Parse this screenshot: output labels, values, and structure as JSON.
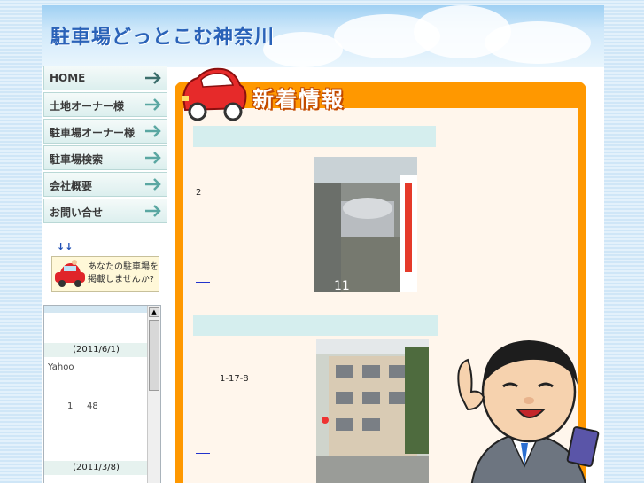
{
  "header": {
    "site_title": "駐車場どっとこむ神奈川"
  },
  "nav": {
    "items": [
      {
        "label": "HOME"
      },
      {
        "label": "土地オーナー様"
      },
      {
        "label": "駐車場オーナー様"
      },
      {
        "label": "駐車場検索"
      },
      {
        "label": "会社概要"
      },
      {
        "label": "お問い合せ"
      }
    ]
  },
  "sidebar": {
    "down_arrows": "↓↓",
    "banner": {
      "line1": "あなたの駐車場を",
      "line2": "掲載しませんか?"
    },
    "news": [
      {
        "date": "(2011/6/1)",
        "text": "Yahoo"
      },
      {
        "number": "1",
        "count": "48"
      },
      {
        "date": "(2011/3/8)"
      }
    ]
  },
  "main": {
    "heading": "新着情報",
    "entries": [
      {
        "text": "2",
        "photo_caption": "11"
      },
      {
        "text": "1-17-8"
      }
    ]
  },
  "colors": {
    "accent": "#ff9800",
    "title": "#2a62b8",
    "bar": "#d5eeee"
  }
}
